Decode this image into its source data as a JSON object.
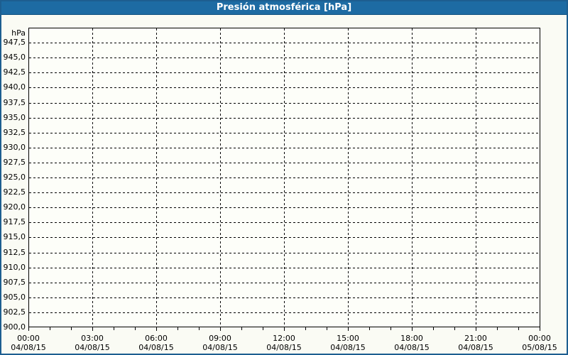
{
  "window": {
    "title": "Presión atmosférica [hPa]"
  },
  "colors": {
    "titlebar_bg": "#1d6ba3",
    "titlebar_border": "#10507f",
    "frame_border": "#1d5e90",
    "page_bg": "#fafbf4",
    "plot_bg": "#fdfef9",
    "grid": "#000000",
    "text": "#000000",
    "title_text": "#ffffff"
  },
  "chart_data": {
    "type": "line",
    "title": "Presión atmosférica [hPa]",
    "xlabel": "",
    "ylabel": "hPa",
    "ylim": [
      900,
      950
    ],
    "ytick_step": 2.5,
    "yticks": [
      {
        "value": 947.5,
        "label": "947,5"
      },
      {
        "value": 945.0,
        "label": "945,0"
      },
      {
        "value": 942.5,
        "label": "942,5"
      },
      {
        "value": 940.0,
        "label": "940,0"
      },
      {
        "value": 937.5,
        "label": "937,5"
      },
      {
        "value": 935.0,
        "label": "935,0"
      },
      {
        "value": 932.5,
        "label": "932,5"
      },
      {
        "value": 930.0,
        "label": "930,0"
      },
      {
        "value": 927.5,
        "label": "927,5"
      },
      {
        "value": 925.0,
        "label": "925,0"
      },
      {
        "value": 922.5,
        "label": "922,5"
      },
      {
        "value": 920.0,
        "label": "920,0"
      },
      {
        "value": 917.5,
        "label": "917,5"
      },
      {
        "value": 915.0,
        "label": "915,0"
      },
      {
        "value": 912.5,
        "label": "912,5"
      },
      {
        "value": 910.0,
        "label": "910,0"
      },
      {
        "value": 907.5,
        "label": "907,5"
      },
      {
        "value": 905.0,
        "label": "905,0"
      },
      {
        "value": 902.5,
        "label": "902,5"
      },
      {
        "value": 900.0,
        "label": "900,0"
      }
    ],
    "xlim_hours": [
      0,
      24
    ],
    "x_major_step_hours": 3,
    "x_minor_step_hours": 1,
    "xticks": [
      {
        "time": "00:00",
        "date": "04/08/15"
      },
      {
        "time": "03:00",
        "date": "04/08/15"
      },
      {
        "time": "06:00",
        "date": "04/08/15"
      },
      {
        "time": "09:00",
        "date": "04/08/15"
      },
      {
        "time": "12:00",
        "date": "04/08/15"
      },
      {
        "time": "15:00",
        "date": "04/08/15"
      },
      {
        "time": "18:00",
        "date": "04/08/15"
      },
      {
        "time": "21:00",
        "date": "04/08/15"
      },
      {
        "time": "00:00",
        "date": "05/08/15"
      }
    ],
    "grid": "dashed",
    "legend": null,
    "series": []
  }
}
